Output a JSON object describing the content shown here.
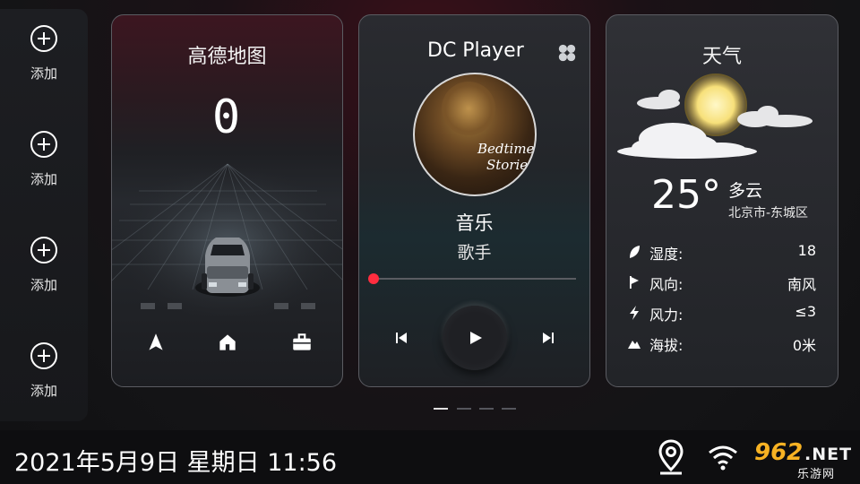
{
  "sidebar": {
    "items": [
      {
        "label": "添加"
      },
      {
        "label": "添加"
      },
      {
        "label": "添加"
      },
      {
        "label": "添加"
      }
    ]
  },
  "map_card": {
    "title": "高德地图",
    "speed": "0",
    "buttons": [
      "navigate-icon",
      "home-icon",
      "briefcase-icon"
    ]
  },
  "music_card": {
    "title": "DC Player",
    "album_text_1": "Bedtime",
    "album_text_2": "Stories",
    "song": "音乐",
    "artist": "歌手",
    "progress": 0.0
  },
  "weather_card": {
    "title": "天气",
    "temperature": "25°",
    "condition": "多云",
    "location": "北京市-东城区",
    "rows": [
      {
        "icon": "leaf-icon",
        "label": "湿度:",
        "value": "18"
      },
      {
        "icon": "flag-icon",
        "label": "风向:",
        "value": "南风"
      },
      {
        "icon": "lightning-icon",
        "label": "风力:",
        "value": "≤3"
      },
      {
        "icon": "mountain-icon",
        "label": "海拔:",
        "value": "0米"
      }
    ]
  },
  "pager": {
    "count": 4,
    "active": 0
  },
  "status_bar": {
    "datetime": "2021年5月9日 星期日 11:56",
    "watermark_main": "962",
    "watermark_net": ".NET",
    "watermark_sub": "乐游网"
  },
  "colors": {
    "accent": "#ff2d3f",
    "watermark": "#f7b223"
  }
}
